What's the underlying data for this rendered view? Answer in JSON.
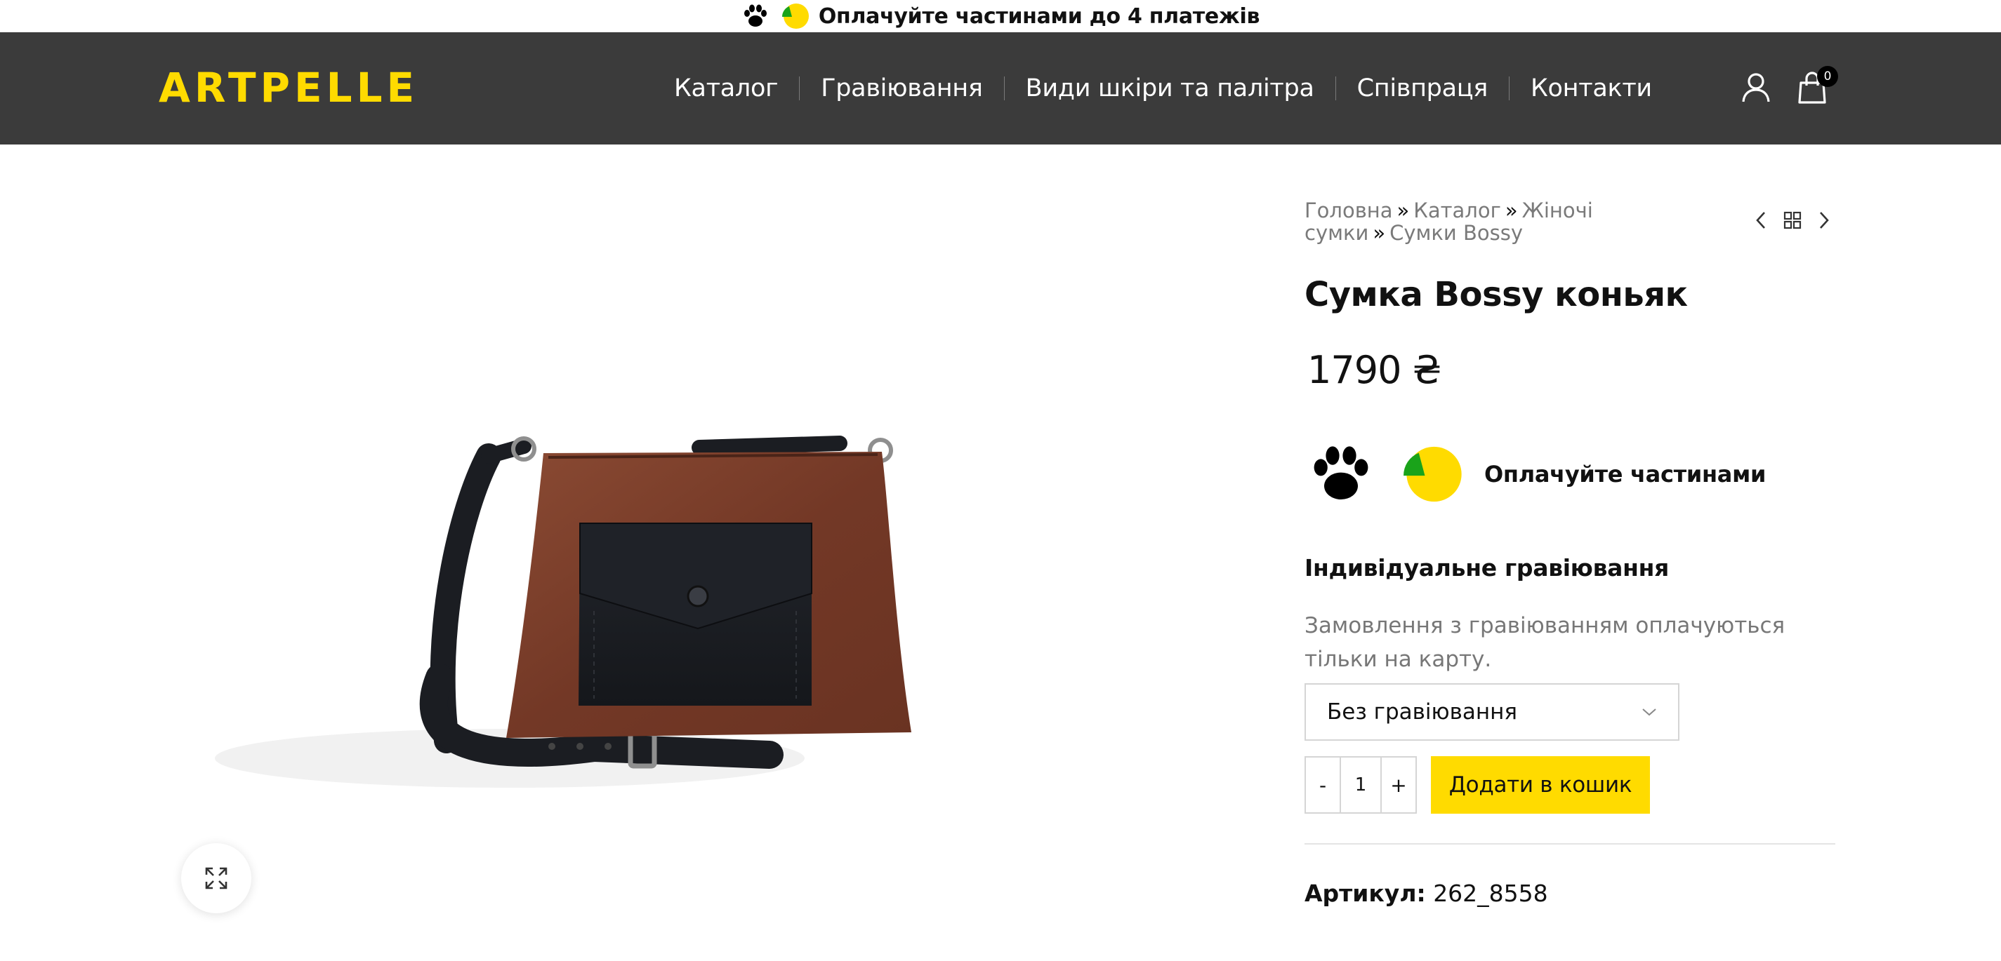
{
  "promo": {
    "text": "Оплачуйте частинами до 4 платежів",
    "icons": [
      "paw-icon",
      "pie-icon"
    ]
  },
  "header": {
    "logo": "ARTPELLE",
    "nav": [
      "Каталог",
      "Гравіювання",
      "Види шкіри та палітра",
      "Співпраця",
      "Контакти"
    ],
    "cart_count": "0",
    "icons": [
      "user-icon",
      "cart-icon"
    ]
  },
  "breadcrumb": {
    "items": [
      "Головна",
      "Каталог",
      "Жіночі сумки",
      "Сумки Bossy"
    ],
    "separator": "»"
  },
  "product": {
    "title": "Сумка Bossy коньяк",
    "price": "1790 ₴",
    "installments_text": "Оплачуйте частинами",
    "engraving_title": "Індивідуальне гравіювання",
    "engraving_note": "Замовлення з гравіюванням оплачуються тільки на карту.",
    "engraving_select": "Без гравіювання",
    "qty_minus": "-",
    "qty_value": "1",
    "qty_plus": "+",
    "add_to_cart": "Додати в кошик",
    "sku_label": "Артикул:",
    "sku_value": "262_8558"
  },
  "colors": {
    "accent": "#ffdb00",
    "header_bg": "#3b3b3b",
    "pie_green": "#1aa31a",
    "leather_brown": "#7a3f2a",
    "leather_black": "#1b1d22"
  }
}
